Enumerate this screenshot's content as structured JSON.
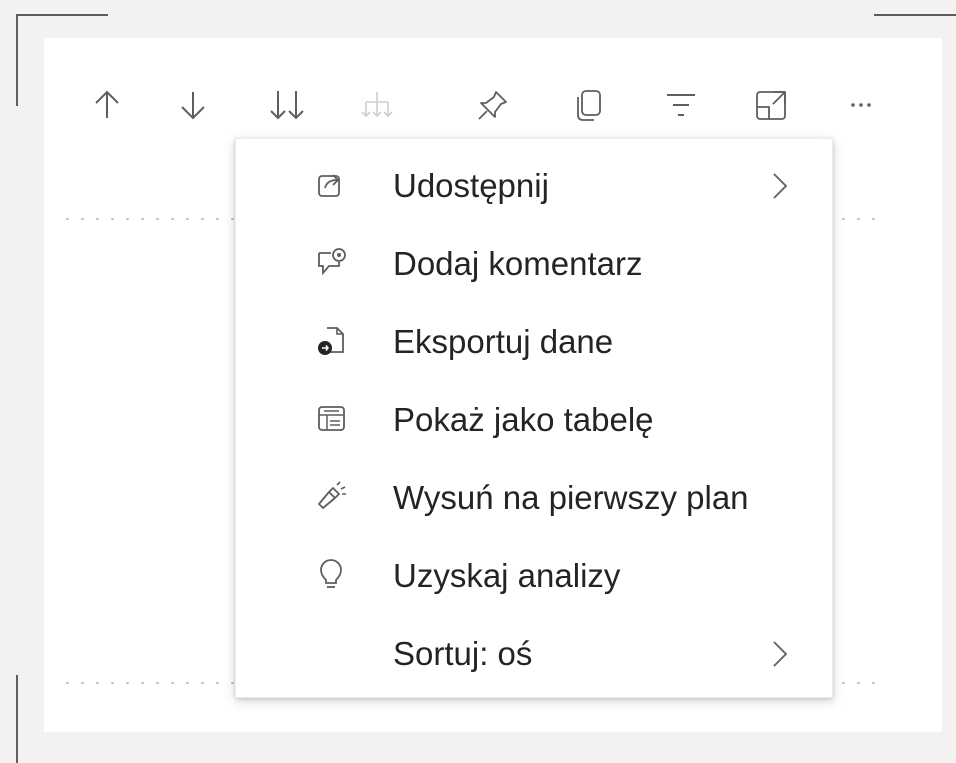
{
  "toolbar": {
    "buttons": [
      {
        "icon": "arrow-up-icon"
      },
      {
        "icon": "arrow-down-icon"
      },
      {
        "icon": "double-arrow-down-icon"
      },
      {
        "icon": "expand-hierarchy-icon"
      },
      {
        "icon": "pin-icon"
      },
      {
        "icon": "copy-visual-icon"
      },
      {
        "icon": "filter-icon"
      },
      {
        "icon": "focus-mode-icon"
      },
      {
        "icon": "more-options-icon"
      }
    ]
  },
  "context_menu": {
    "items": [
      {
        "label": "Udostępnij",
        "icon": "share-icon",
        "has_submenu": true
      },
      {
        "label": "Dodaj komentarz",
        "icon": "comment-icon",
        "has_submenu": false
      },
      {
        "label": "Eksportuj dane",
        "icon": "export-data-icon",
        "has_submenu": false
      },
      {
        "label": "Pokaż jako tabelę",
        "icon": "table-view-icon",
        "has_submenu": false
      },
      {
        "label": "Wysuń na pierwszy plan",
        "icon": "spotlight-icon",
        "has_submenu": false
      },
      {
        "label": "Uzyskaj analizy",
        "icon": "lightbulb-icon",
        "has_submenu": false
      },
      {
        "label": "Sortuj: oś",
        "icon": "",
        "has_submenu": true
      }
    ]
  },
  "colors": {
    "background": "#f3f2f1",
    "card": "#ffffff",
    "text": "#252423",
    "icon": "#605e5c",
    "menu_border": "#edebe9"
  }
}
